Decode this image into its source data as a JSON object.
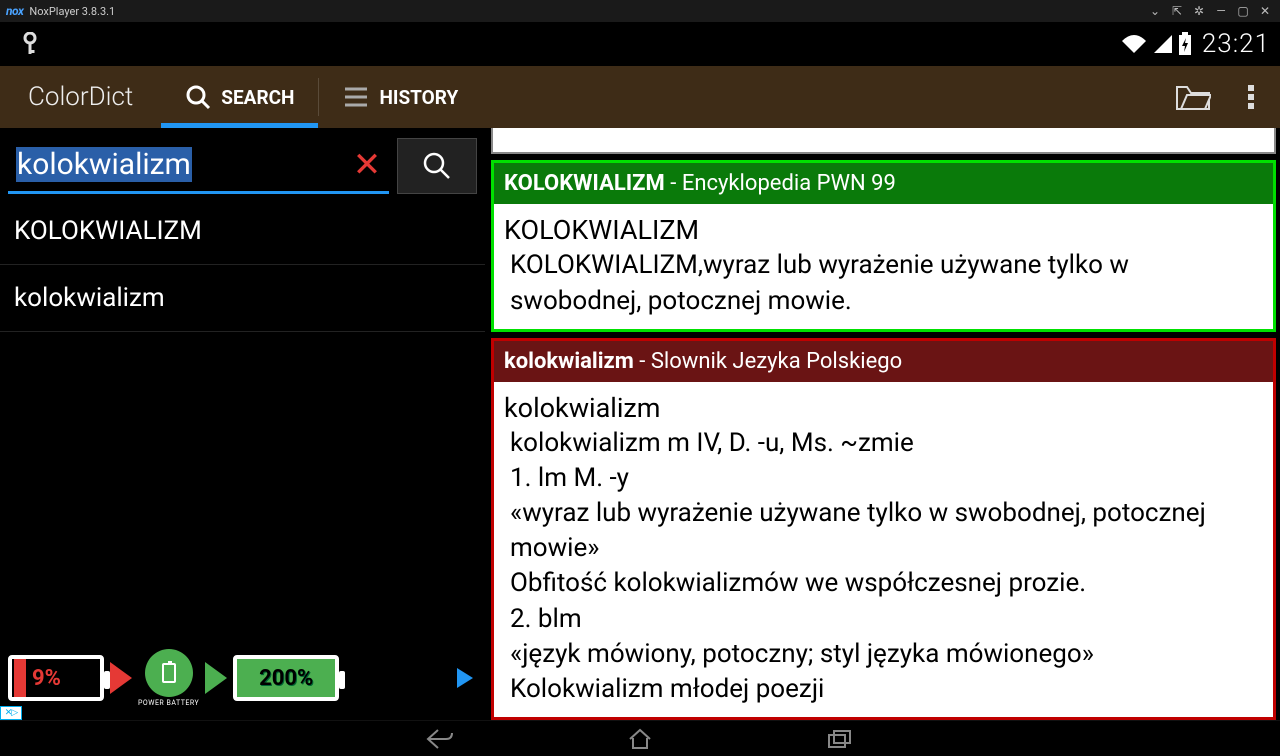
{
  "nox": {
    "title": "NoxPlayer 3.8.3.1"
  },
  "status": {
    "time": "23:21"
  },
  "app": {
    "title": "ColorDict",
    "tab_search": "SEARCH",
    "tab_history": "HISTORY"
  },
  "search": {
    "value": "kolokwializm"
  },
  "results": [
    "KOLOKWIALIZM",
    "kolokwializm"
  ],
  "ad": {
    "low": "9%",
    "high": "200%",
    "brand": "POWER BATTERY"
  },
  "defs": [
    {
      "color": "green",
      "headword": "KOLOKWIALIZM",
      "source": "Encyklopedia PWN 99",
      "title": "KOLOKWIALIZM",
      "body": " KOLOKWIALIZM,wyraz lub wyrażenie używane tylko w swobodnej, potocznej mowie."
    },
    {
      "color": "red",
      "headword": "kolokwializm",
      "source": "Slownik Jezyka Polskiego",
      "title": "kolokwializm",
      "body_lines": [
        " kolokwializm m IV, D. -u, Ms. ~zmie",
        "1. lm M. -y",
        "«wyraz lub wyrażenie używane tylko w swobodnej, potocznej mowie»",
        "   Obfitość kolokwializmów we współczesnej prozie.",
        "",
        "2. blm",
        "«język mówiony, potoczny; styl języka mówionego»",
        "   Kolokwializm młodej poezji"
      ]
    }
  ]
}
